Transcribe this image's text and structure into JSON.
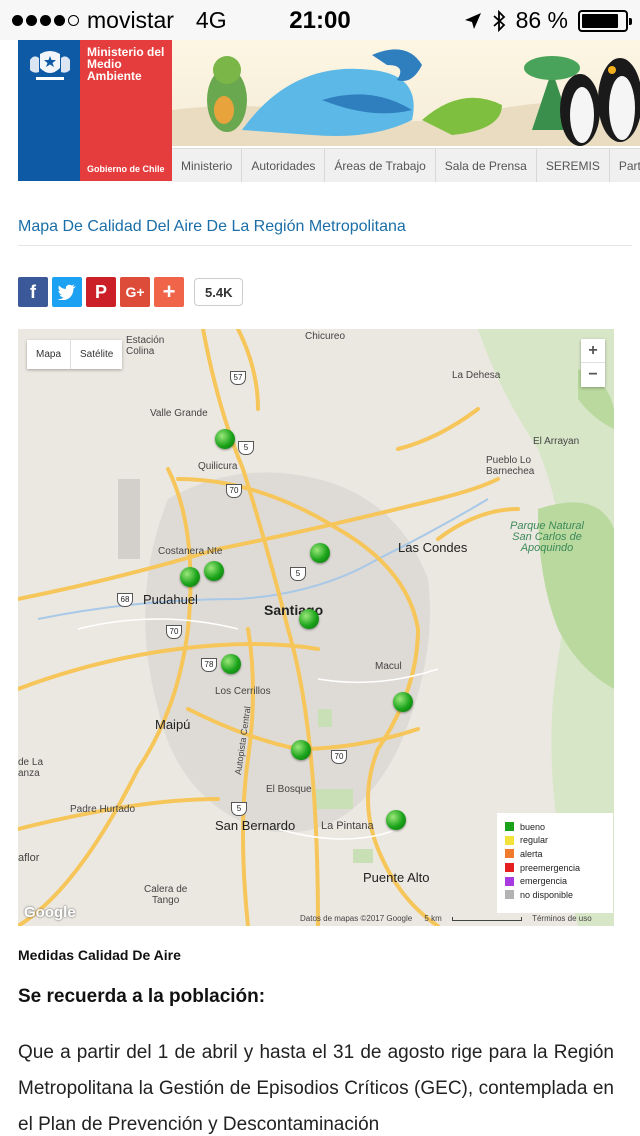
{
  "status_bar": {
    "carrier": "movistar",
    "network": "4G",
    "time": "21:00",
    "battery": "86 %",
    "battery_level": 0.86,
    "signal_bars": 4,
    "signal_total": 5
  },
  "header": {
    "ministry_name": "Ministerio del Medio Ambiente",
    "government": "Gobierno de Chile",
    "nav": [
      "Ministerio",
      "Autoridades",
      "Áreas de Trabajo",
      "Sala de Prensa",
      "SEREMIS",
      "Particip"
    ]
  },
  "page_title": "Mapa De Calidad Del Aire De La Región Metropolitana",
  "share": {
    "facebook": "f",
    "twitter": "t",
    "pinterest": "P",
    "googleplus": "G+",
    "add": "+",
    "count": "5.4K"
  },
  "map": {
    "type_buttons": [
      "Mapa",
      "Satélite"
    ],
    "zoom_in": "+",
    "zoom_out": "−",
    "places": {
      "estacion_colina": "Estación\nColina",
      "chicureo": "Chicureo",
      "la_dehesa": "La Dehesa",
      "valle_grande": "Valle Grande",
      "el_arrayan": "El Arrayan",
      "quilicura": "Quilicura",
      "pueblo_lo_barnechea": "Pueblo Lo\nBarnechea",
      "parque_natural": "Parque Natural\nSan Carlos de\nApoquindo",
      "costanera_nte": "Costanera Nte",
      "las_condes": "Las Condes",
      "pudahuel": "Pudahuel",
      "santiago": "Santiago",
      "macul": "Macul",
      "los_cerrillos": "Los Cerrillos",
      "maipu": "Maipú",
      "autopista_central": "Autopista Central",
      "de_la_anza": "de La\nanza",
      "el_bosque": "El Bosque",
      "padre_hurtado": "Padre Hurtado",
      "san_bernardo": "San Bernardo",
      "la_pintana": "La Pintana",
      "puente_alto": "Puente Alto",
      "aflor": "aflor",
      "calera_de_tango": "Calera de\nTango"
    },
    "route_shields": [
      "57",
      "5",
      "70",
      "5",
      "68",
      "70",
      "78",
      "70",
      "5"
    ],
    "stations_status": "bueno",
    "legend": [
      {
        "label": "bueno",
        "color": "#1aa31a"
      },
      {
        "label": "regular",
        "color": "#f2e23a"
      },
      {
        "label": "alerta",
        "color": "#f07b2c"
      },
      {
        "label": "preemergencia",
        "color": "#e51f1f"
      },
      {
        "label": "emergencia",
        "color": "#a83bdf"
      },
      {
        "label": "no disponible",
        "color": "#b3b3b3"
      }
    ],
    "google": "Google",
    "attribution": "Datos de mapas ©2017 Google",
    "scale": "5 km",
    "terms": "Términos de uso"
  },
  "measures_title": "Medidas Calidad De Aire",
  "reminder": "Se recuerda a la población:",
  "body": "Que a partir del 1 de abril y hasta el 31 de agosto rige para la Región Metropolitana la Gestión de Episodios Críticos (GEC), contemplada en el Plan de Prevención y Descontaminación"
}
